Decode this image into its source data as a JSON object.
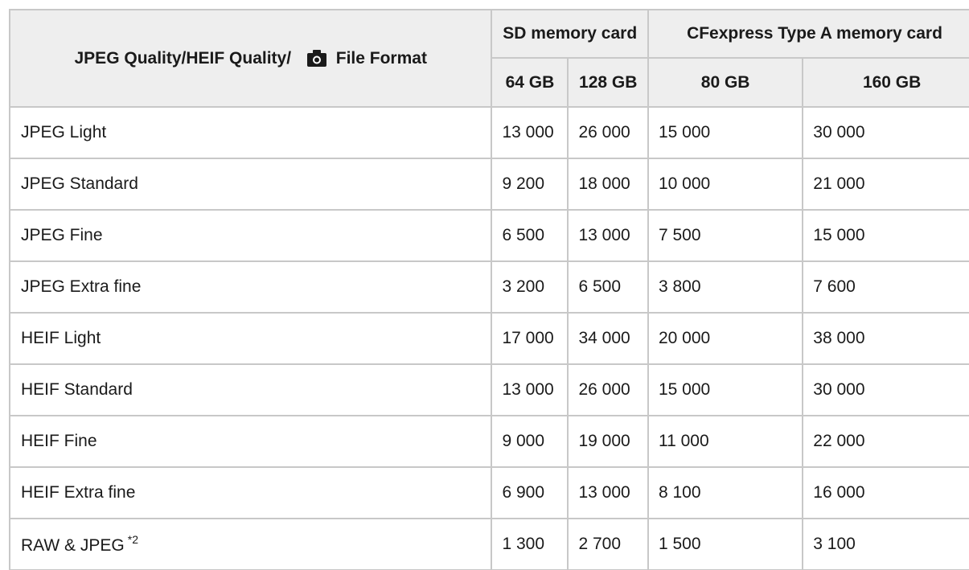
{
  "table": {
    "header": {
      "label_part1": "JPEG Quality/HEIF Quality/",
      "label_part2": "File Format",
      "sd_group": "SD memory card",
      "cf_group": "CFexpress Type A memory card",
      "sd_64": "64 GB",
      "sd_128": "128 GB",
      "cf_80": "80 GB",
      "cf_160": "160 GB"
    },
    "rows": [
      {
        "label": "JPEG Light",
        "sd64": "13 000",
        "sd128": "26 000",
        "cf80": "15 000",
        "cf160": "30 000"
      },
      {
        "label": "JPEG Standard",
        "sd64": "9 200",
        "sd128": "18 000",
        "cf80": "10 000",
        "cf160": "21 000"
      },
      {
        "label": "JPEG Fine",
        "sd64": "6 500",
        "sd128": "13 000",
        "cf80": "7 500",
        "cf160": "15 000"
      },
      {
        "label": "JPEG Extra fine",
        "sd64": "3 200",
        "sd128": "6 500",
        "cf80": "3 800",
        "cf160": "7 600"
      },
      {
        "label": "HEIF Light",
        "sd64": "17 000",
        "sd128": "34 000",
        "cf80": "20 000",
        "cf160": "38 000"
      },
      {
        "label": "HEIF Standard",
        "sd64": "13 000",
        "sd128": "26 000",
        "cf80": "15 000",
        "cf160": "30 000"
      },
      {
        "label": "HEIF Fine",
        "sd64": "9 000",
        "sd128": "19 000",
        "cf80": "11 000",
        "cf160": "22 000"
      },
      {
        "label": "HEIF Extra fine",
        "sd64": "6 900",
        "sd128": "13 000",
        "cf80": "8 100",
        "cf160": "16 000"
      },
      {
        "label": "RAW & JPEG",
        "footnote": "*2",
        "sd64": "1 300",
        "sd128": "2 700",
        "cf80": "1 500",
        "cf160": "3 100"
      }
    ]
  },
  "icons": {
    "camera": "camera-icon"
  },
  "colors": {
    "header_bg": "#eeeeee",
    "border": "#c8c8c8",
    "text": "#1a1a1a"
  }
}
